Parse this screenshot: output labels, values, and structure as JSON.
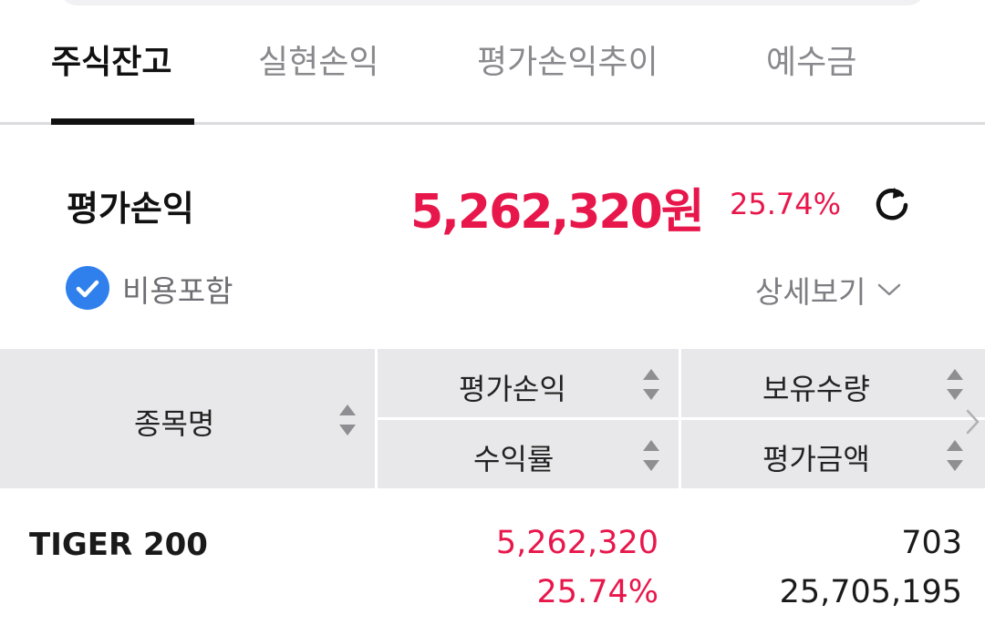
{
  "tabs": [
    {
      "label": "주식잔고",
      "active": true
    },
    {
      "label": "실현손익",
      "active": false
    },
    {
      "label": "평가손익추이",
      "active": false
    },
    {
      "label": "예수금",
      "active": false
    }
  ],
  "summary": {
    "label": "평가손익",
    "amount": "5,262,320원",
    "rate": "25.74%",
    "include_fee_label": "비용포함",
    "include_fee_checked": true,
    "detail_label": "상세보기"
  },
  "table": {
    "headers": {
      "name": "종목명",
      "profit_loss": "평가손익",
      "return_rate": "수익률",
      "quantity": "보유수량",
      "valuation": "평가금액"
    },
    "rows": [
      {
        "name": "TIGER 200",
        "profit_loss": "5,262,320",
        "return_rate": "25.74%",
        "quantity": "703",
        "valuation": "25,705,195"
      }
    ]
  },
  "colors": {
    "accent_red": "#e8174b",
    "check_blue": "#2f80ed",
    "header_gray": "#e8e8ea"
  },
  "icons": [
    "refresh-icon",
    "checkmark-icon",
    "chevron-down-icon",
    "sort-icon",
    "chevron-right-icon"
  ]
}
